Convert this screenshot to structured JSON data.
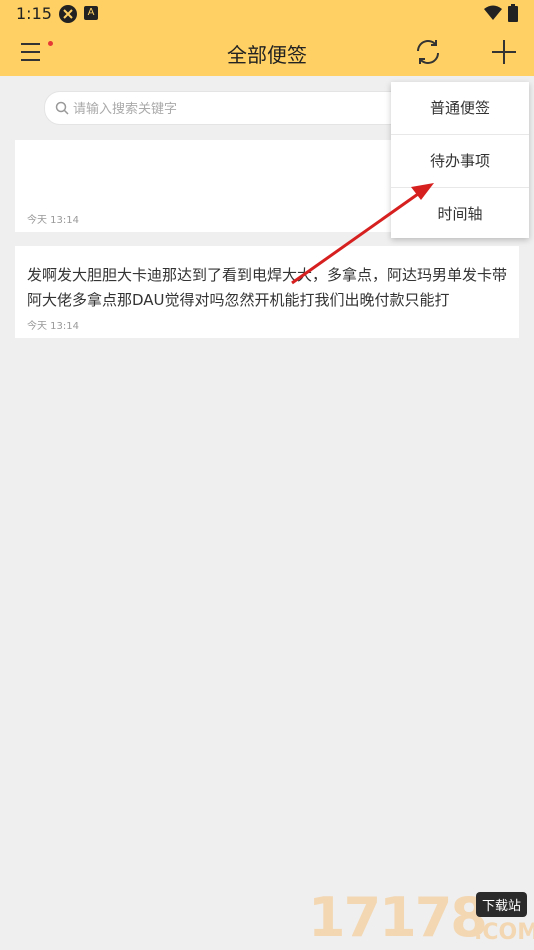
{
  "status_bar": {
    "time": "1:15",
    "app_icon_letter": "A"
  },
  "app_bar": {
    "title": "全部便签"
  },
  "search": {
    "placeholder": "请输入搜索关键字"
  },
  "notes": [
    {
      "text": "",
      "time": "今天 13:14"
    },
    {
      "text": "发啊发大胆胆大卡迪那达到了看到电焊大大，多拿点，阿达玛男单发卡带阿大佬多拿点那DAU觉得对吗忽然开机能打我们出晚付款只能打",
      "time": "今天 13:14"
    }
  ],
  "dropdown_menu": {
    "items": [
      {
        "label": "普通便签"
      },
      {
        "label": "待办事项"
      },
      {
        "label": "时间轴"
      }
    ]
  },
  "watermark": {
    "digits": "17178",
    "badge": "下载站",
    "domain": ".COM"
  },
  "colors": {
    "accent": "#ffd164",
    "background": "#efefef",
    "annotation_arrow": "#d62020",
    "notify_dot": "#e53935"
  },
  "icons": {
    "menu": "menu-icon",
    "sync": "sync-icon",
    "add": "plus-icon",
    "search": "search-icon"
  }
}
